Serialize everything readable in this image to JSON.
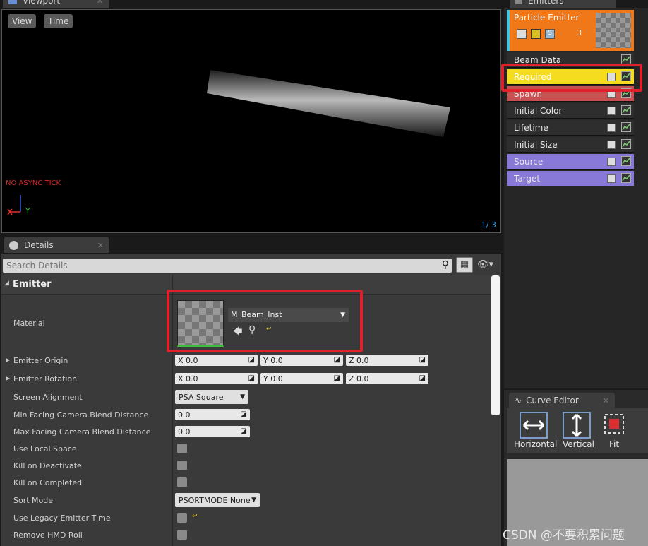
{
  "viewport": {
    "tab_label": "Viewport",
    "view_btn": "View",
    "time_btn": "Time",
    "warning": "NO ASYNC TICK",
    "axis_y": "Y",
    "counter": "1/  3"
  },
  "details": {
    "tab_label": "Details",
    "search_placeholder": "Search Details",
    "section": "Emitter",
    "material_label": "Material",
    "material_value": "M_Beam_Inst",
    "rows": {
      "emitter_origin": "Emitter Origin",
      "emitter_rotation": "Emitter Rotation",
      "screen_alignment": "Screen Alignment",
      "min_facing": "Min Facing Camera Blend Distance",
      "max_facing": "Max Facing Camera Blend Distance",
      "use_local_space": "Use Local Space",
      "kill_on_deactivate": "Kill on Deactivate",
      "kill_on_completed": "Kill on Completed",
      "sort_mode": "Sort Mode",
      "use_legacy": "Use Legacy Emitter Time",
      "remove_hmd": "Remove HMD Roll"
    },
    "origin": {
      "x": "X  0.0",
      "y": "Y  0.0",
      "z": "Z  0.0"
    },
    "rotation": {
      "x": "X  0.0",
      "y": "Y  0.0",
      "z": "Z  0.0"
    },
    "screen_alignment_value": "PSA Square",
    "min_facing_value": "0.0",
    "max_facing_value": "0.0",
    "sort_mode_value": "PSORTMODE None"
  },
  "emitters": {
    "tab_label": "Emitters",
    "emitter_name": "Particle Emitter",
    "emitter_count": "3",
    "modules": [
      {
        "label": "Beam Data",
        "color": "#2e2e2e"
      },
      {
        "label": "Required",
        "color": "#f5dc1e"
      },
      {
        "label": "Spawn",
        "color": "#c85050"
      },
      {
        "label": "Initial Color",
        "color": "#2e2e2e"
      },
      {
        "label": "Lifetime",
        "color": "#2e2e2e"
      },
      {
        "label": "Initial Size",
        "color": "#2e2e2e"
      },
      {
        "label": "Source",
        "color": "#8878d8"
      },
      {
        "label": "Target",
        "color": "#8878d8"
      }
    ]
  },
  "curve_editor": {
    "tab_label": "Curve Editor",
    "horizontal": "Horizontal",
    "vertical": "Vertical",
    "fit": "Fit"
  },
  "watermark": "CSDN @不要积累问题"
}
